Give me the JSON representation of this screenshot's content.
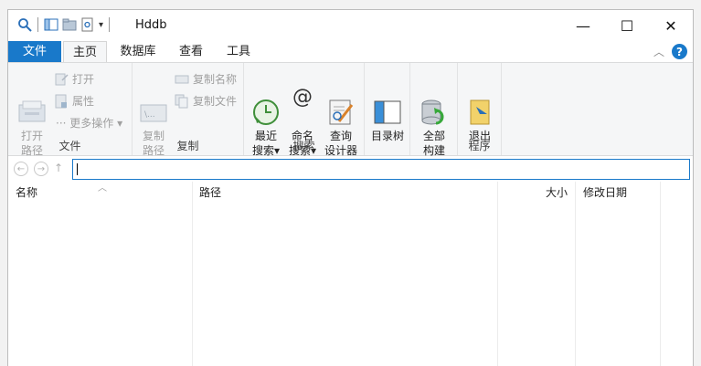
{
  "window": {
    "title": "Hddb"
  },
  "title_buttons": {
    "minimize": "—",
    "maximize": "☐",
    "close": "✕"
  },
  "tabs": [
    "文件",
    "主页",
    "数据库",
    "查看",
    "工具"
  ],
  "ribbon": {
    "group_file": {
      "label": "文件",
      "open_path": "打开\n路径",
      "open": "打开",
      "properties": "属性",
      "more_ops": "··· 更多操作 ▾"
    },
    "group_copy": {
      "label": "复制",
      "copy_path": "复制\n路径",
      "copy_name": "复制名称",
      "copy_file": "复制文件"
    },
    "group_search": {
      "label": "搜索",
      "recent_search": "最近\n搜索▾",
      "name_search": "命名\n搜索▾",
      "query_designer": "查询\n设计器"
    },
    "group_tree": {
      "dir_tree": "目录树"
    },
    "group_build": {
      "full_build": "全部\n构建"
    },
    "group_program": {
      "label": "程序",
      "exit": "退出"
    }
  },
  "address": {
    "value": ""
  },
  "columns": [
    "名称",
    "路径",
    "大小",
    "修改日期"
  ],
  "colors": {
    "accent": "#1979ca",
    "ribbon_bg": "#f5f6f7"
  }
}
